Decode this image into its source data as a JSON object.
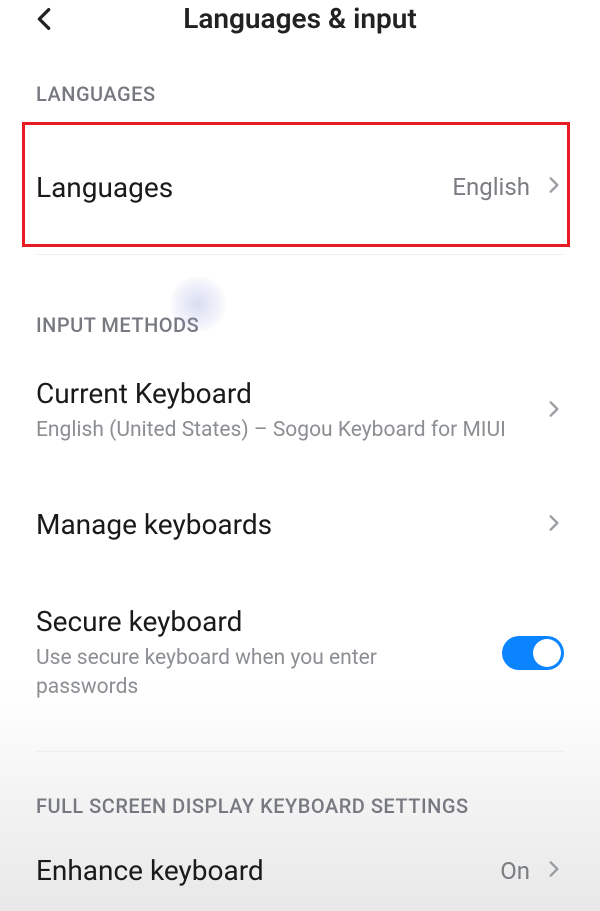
{
  "header": {
    "title": "Languages & input"
  },
  "sections": {
    "languages": {
      "header": "LANGUAGES",
      "languagesRow": {
        "title": "Languages",
        "value": "English"
      }
    },
    "inputMethods": {
      "header": "INPUT METHODS",
      "currentKeyboard": {
        "title": "Current Keyboard",
        "subtitle": "English (United States) – Sogou Keyboard for MIUI"
      },
      "manageKeyboards": {
        "title": "Manage keyboards"
      },
      "secureKeyboard": {
        "title": "Secure keyboard",
        "subtitle": "Use secure keyboard when you enter passwords",
        "enabled": true
      }
    },
    "fullScreen": {
      "header": "FULL SCREEN DISPLAY KEYBOARD SETTINGS",
      "enhanceKeyboard": {
        "title": "Enhance keyboard",
        "value": "On"
      }
    }
  }
}
